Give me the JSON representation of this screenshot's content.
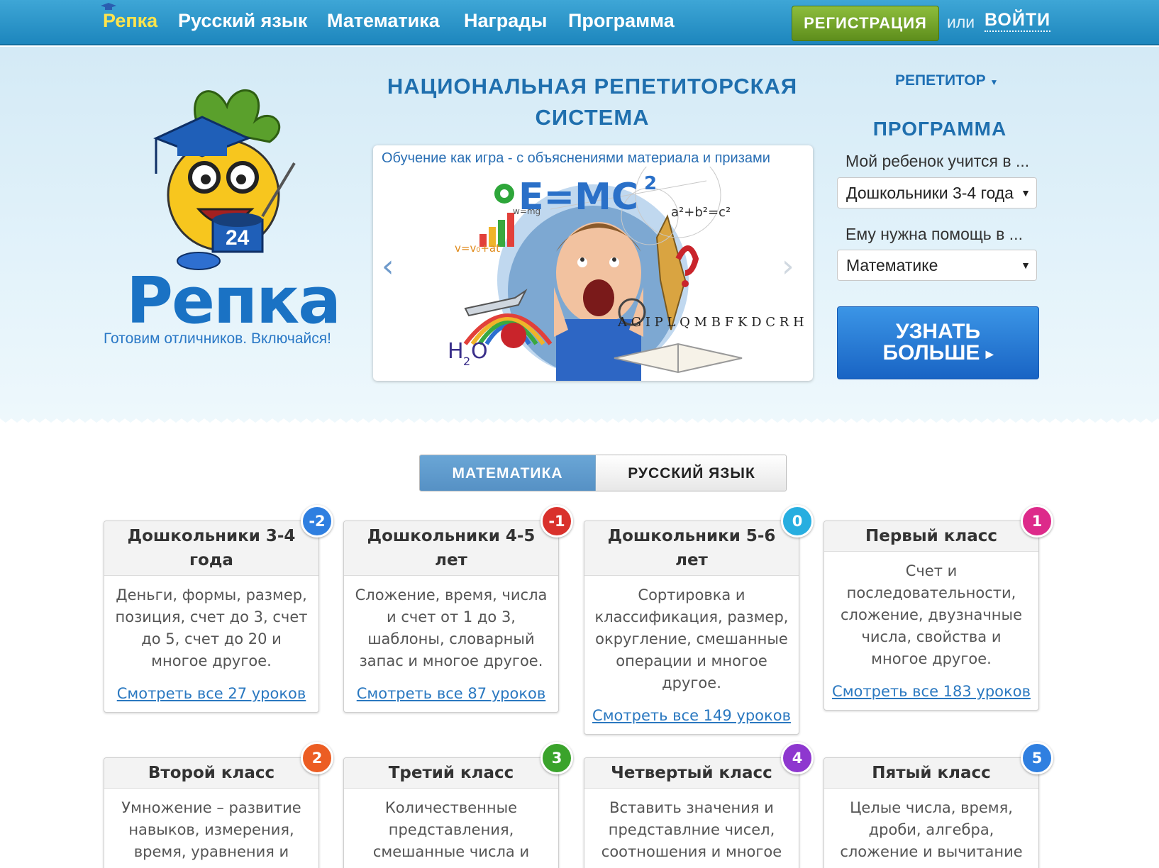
{
  "nav": {
    "brand": "Репка",
    "links": [
      "Русский язык",
      "Математика",
      "Награды",
      "Программа"
    ],
    "register": "РЕГИСТРАЦИЯ",
    "or": "или",
    "login": "ВОЙТИ"
  },
  "logo": {
    "wordmark": "Репка",
    "slogan": "Готовим отличников. Включайся!",
    "mascot_label": "24"
  },
  "hero": {
    "title": "НАЦИОНАЛЬНАЯ РЕПЕТИТОРСКАЯ СИСТЕМА",
    "slider_caption": "Обучение как игра - с объяснениями материала и призами",
    "prev_icon": "chevron-left-icon",
    "next_icon": "chevron-right-icon",
    "art_text": {
      "formula": "E=MC",
      "formula_exp": "2",
      "pythagoras": "a²+b²=c²",
      "force": "w=mg",
      "velocity": "v=v₀+at",
      "water": "H",
      "water_sub": "2",
      "water_o": "O",
      "letters": "A G I P L Q M B F K D C R H"
    }
  },
  "program": {
    "tutor_dropdown": "РЕПЕТИТОР",
    "title": "ПРОГРАММА",
    "child_label": "Мой ребенок учится в ...",
    "child_value": "Дошкольники 3-4 года",
    "help_label": "Ему нужна помощь в ...",
    "help_value": "Математике",
    "learn_more_line1": "УЗНАТЬ",
    "learn_more_line2": "БОЛЬШЕ"
  },
  "tabs": {
    "math": "МАТЕМАТИКА",
    "russian": "РУССКИЙ ЯЗЫК",
    "active": "math"
  },
  "cards": [
    {
      "title": "Дошкольники 3-4 года",
      "badge": "-2",
      "badge_color": "#2f7fe0",
      "desc": "Деньги, формы, размер, позиция, счет до 3, счет до 5, счет до 20 и многое другое.",
      "link": "Смотреть все 27 уроков"
    },
    {
      "title": "Дошкольники 4-5 лет",
      "badge": "-1",
      "badge_color": "#d9312c",
      "desc": "Сложение, время, числа и счет от 1 до 3, шаблоны, словарный запас и многое другое.",
      "link": "Смотреть все 87 уроков"
    },
    {
      "title": "Дошкольники 5-6 лет",
      "badge": "0",
      "badge_color": "#27aee0",
      "desc": "Сортировка и классификация, размер, округление, смешанные операции и многое другое.",
      "link": "Смотреть все 149 уроков"
    },
    {
      "title": "Первый класс",
      "badge": "1",
      "badge_color": "#dd2a8a",
      "desc": "Счет и последовательности, сложение, двузначные числа, свойства и многое другое.",
      "link": "Смотреть все 183 уроков"
    },
    {
      "title": "Второй класс",
      "badge": "2",
      "badge_color": "#ec5d23",
      "desc": "Умножение – развитие навыков, измерения, время, уравнения и",
      "link": ""
    },
    {
      "title": "Третий класс",
      "badge": "3",
      "badge_color": "#3aa32b",
      "desc": "Количественные представления, смешанные числа и",
      "link": ""
    },
    {
      "title": "Четвертый класс",
      "badge": "4",
      "badge_color": "#8e37cf",
      "desc": "Вставить значения и представлние чисел, соотношения и многое",
      "link": ""
    },
    {
      "title": "Пятый класс",
      "badge": "5",
      "badge_color": "#2f7fe0",
      "desc": "Целые числа, время, дроби, алгебра, сложение и вычитание целых и",
      "link": ""
    }
  ]
}
